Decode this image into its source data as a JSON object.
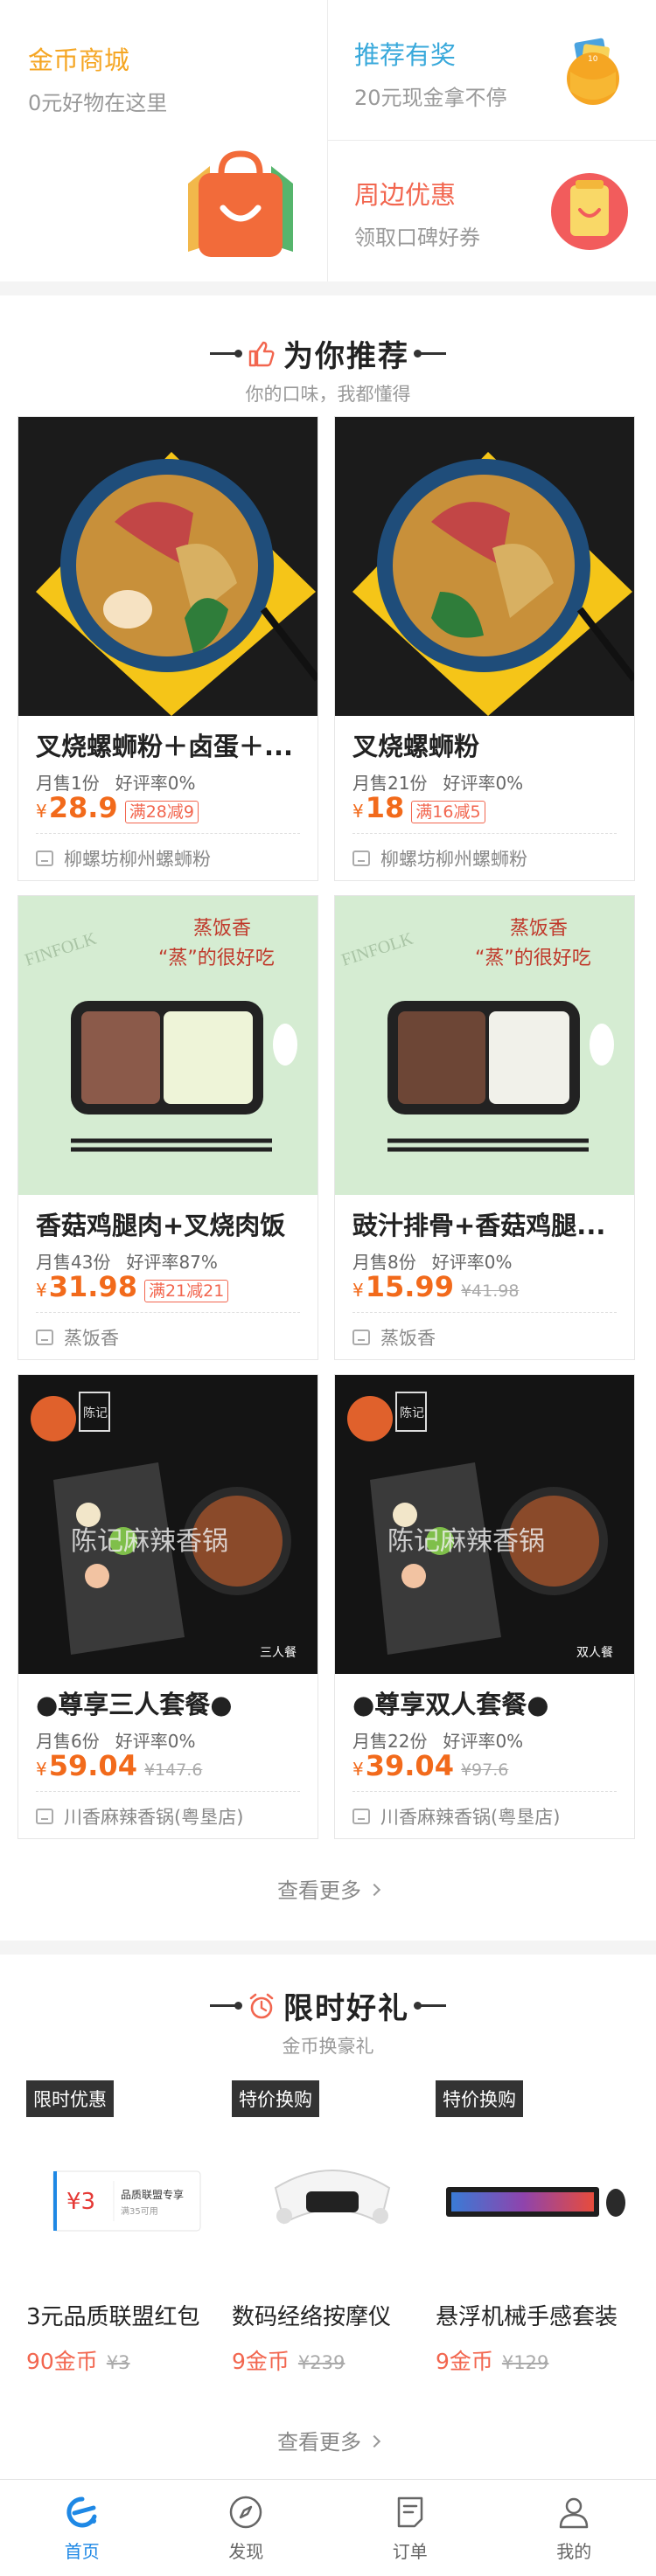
{
  "promos": {
    "gold": {
      "title": "金币商城",
      "sub": "0元好物在这里",
      "color": "#f5a623"
    },
    "recommend": {
      "title": "推荐有奖",
      "sub": "20元现金拿不停",
      "color": "#39a9db"
    },
    "nearby": {
      "title": "周边优惠",
      "sub": "领取口碑好券",
      "color": "#f2664f"
    }
  },
  "for_you": {
    "title": "为你推荐",
    "sub": "你的口味，我都懂得",
    "more": "查看更多",
    "cards": [
      {
        "name": "叉烧螺蛳粉＋卤蛋＋...",
        "sold": "月售1份",
        "rating": "好评率0%",
        "currency": "¥",
        "price": "28.9",
        "tag": "满28减9",
        "orig": "",
        "shop": "柳螺坊柳州螺蛳粉"
      },
      {
        "name": "叉烧螺蛳粉",
        "sold": "月售21份",
        "rating": "好评率0%",
        "currency": "¥",
        "price": "18",
        "tag": "满16减5",
        "orig": "",
        "shop": "柳螺坊柳州螺蛳粉"
      },
      {
        "name": "香菇鸡腿肉+叉烧肉饭",
        "sold": "月售43份",
        "rating": "好评率87%",
        "currency": "¥",
        "price": "31.98",
        "tag": "满21减21",
        "orig": "",
        "shop": "蒸饭香"
      },
      {
        "name": "豉汁排骨+香菇鸡腿...",
        "sold": "月售8份",
        "rating": "好评率0%",
        "currency": "¥",
        "price": "15.99",
        "tag": "",
        "orig": "¥41.98",
        "shop": "蒸饭香"
      },
      {
        "name": "●尊享三人套餐●",
        "sold": "月售6份",
        "rating": "好评率0%",
        "currency": "¥",
        "price": "59.04",
        "tag": "",
        "orig": "¥147.6",
        "shop": "川香麻辣香锅(粤垦店)"
      },
      {
        "name": "●尊享双人套餐●",
        "sold": "月售22份",
        "rating": "好评率0%",
        "currency": "¥",
        "price": "39.04",
        "tag": "",
        "orig": "¥97.6",
        "shop": "川香麻辣香锅(粤垦店)"
      }
    ],
    "image_text": {
      "steam_brand": "蒸饭香",
      "steam_slogan": "“蒸”的很好吃",
      "finfolk": "FINFOLK",
      "chen_brand": "陈记麻辣香锅",
      "chen_logo": "陈记",
      "three": "三人餐",
      "two": "双人餐"
    }
  },
  "gifts": {
    "title": "限时好礼",
    "sub": "金币换豪礼",
    "more": "查看更多",
    "items": [
      {
        "tag": "限时优惠",
        "name": "3元品质联盟红包",
        "price": "90金币",
        "orig": "¥3",
        "coupon_amount": "¥3",
        "coupon_title": "品质联盟专享",
        "coupon_cond": "满35可用"
      },
      {
        "tag": "特价换购",
        "name": "数码经络按摩仪",
        "price": "9金币",
        "orig": "¥239"
      },
      {
        "tag": "特价换购",
        "name": "悬浮机械手感套装",
        "price": "9金币",
        "orig": "¥129"
      }
    ]
  },
  "tabbar": [
    {
      "label": "首页",
      "icon": "home-e-icon",
      "active": true
    },
    {
      "label": "发现",
      "icon": "compass-icon",
      "active": false
    },
    {
      "label": "订单",
      "icon": "order-icon",
      "active": false
    },
    {
      "label": "我的",
      "icon": "user-icon",
      "active": false
    }
  ],
  "colors": {
    "accent": "#1e88e5",
    "price": "#f26a1b",
    "promo_red": "#f2664f"
  }
}
